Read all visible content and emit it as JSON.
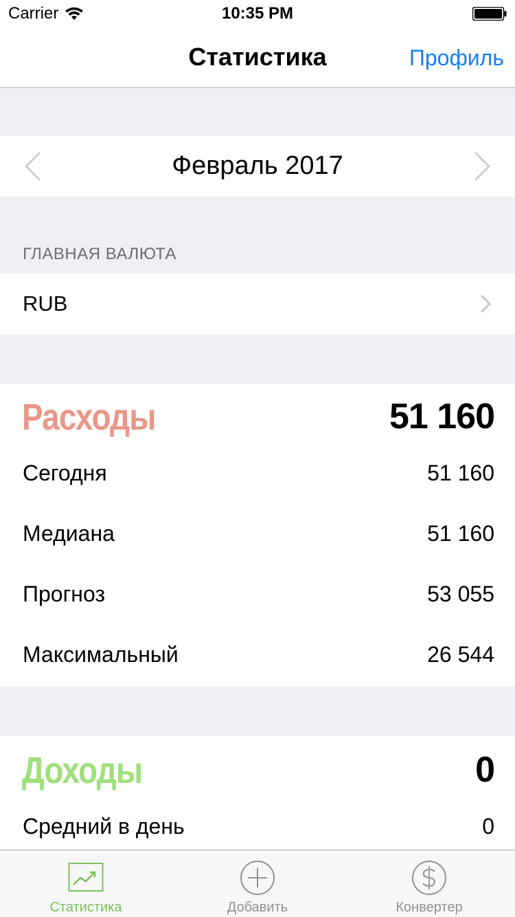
{
  "status_bar": {
    "carrier": "Carrier",
    "time": "10:35 PM",
    "icons": [
      "wifi-icon",
      "battery-icon"
    ]
  },
  "nav": {
    "title": "Статистика",
    "right_button": "Профиль"
  },
  "month_selector": {
    "label": "Февраль 2017",
    "icons": [
      "chevron-left-icon",
      "chevron-right-icon"
    ]
  },
  "currency": {
    "section_header": "ГЛАВНАЯ ВАЛЮТА",
    "value": "RUB"
  },
  "expenses": {
    "title": "Расходы",
    "total": "51 160",
    "rows": [
      {
        "label": "Сегодня",
        "value": "51 160"
      },
      {
        "label": "Медиана",
        "value": "51 160"
      },
      {
        "label": "Прогноз",
        "value": "53 055"
      },
      {
        "label": "Максимальный",
        "value": "26 544"
      }
    ]
  },
  "income": {
    "title": "Доходы",
    "total": "0",
    "rows": [
      {
        "label": "Средний в день",
        "value": "0"
      }
    ]
  },
  "tab_bar": {
    "tabs": [
      {
        "label": "Статистика",
        "icon": "chart-icon",
        "active": true
      },
      {
        "label": "Добавить",
        "icon": "plus-circle-icon",
        "active": false
      },
      {
        "label": "Конвертер",
        "icon": "dollar-circle-icon",
        "active": false
      }
    ]
  },
  "colors": {
    "accent": "#147efb",
    "expenses": "#e8988a",
    "income": "#9ee07a",
    "tab_active": "#7cc05d",
    "background": "#efeff4"
  }
}
